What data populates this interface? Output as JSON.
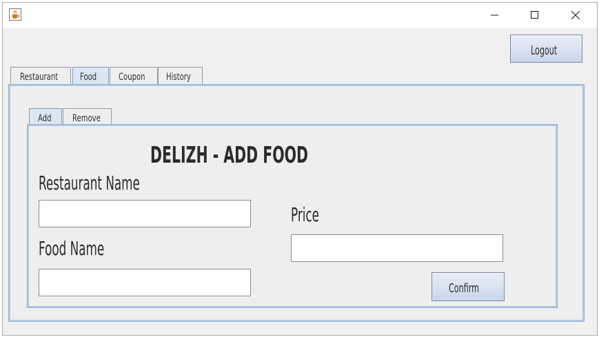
{
  "window": {
    "icon": "java-cup-icon",
    "controls": [
      "minimize-icon",
      "maximize-icon",
      "close-icon"
    ]
  },
  "header": {
    "logout_label": "Logout"
  },
  "tabs": [
    {
      "label": "Restaurant",
      "active": false
    },
    {
      "label": "Food",
      "active": true
    },
    {
      "label": "Coupon",
      "active": false
    },
    {
      "label": "History",
      "active": false
    }
  ],
  "subtabs": [
    {
      "label": "Add",
      "active": true
    },
    {
      "label": "Remove",
      "active": false
    }
  ],
  "form": {
    "title": "DELIZH - ADD FOOD",
    "restaurant_name_label": "Restaurant Name",
    "restaurant_name_value": "",
    "food_name_label": "Food Name",
    "food_name_value": "",
    "price_label": "Price",
    "price_value": "",
    "confirm_label": "Confirm"
  },
  "colors": {
    "active_tab": "#dbe6f3",
    "panel_border": "#b3c9e3",
    "button_gradient_top": "#e9eef6",
    "button_gradient_bottom": "#c8d6ea"
  }
}
